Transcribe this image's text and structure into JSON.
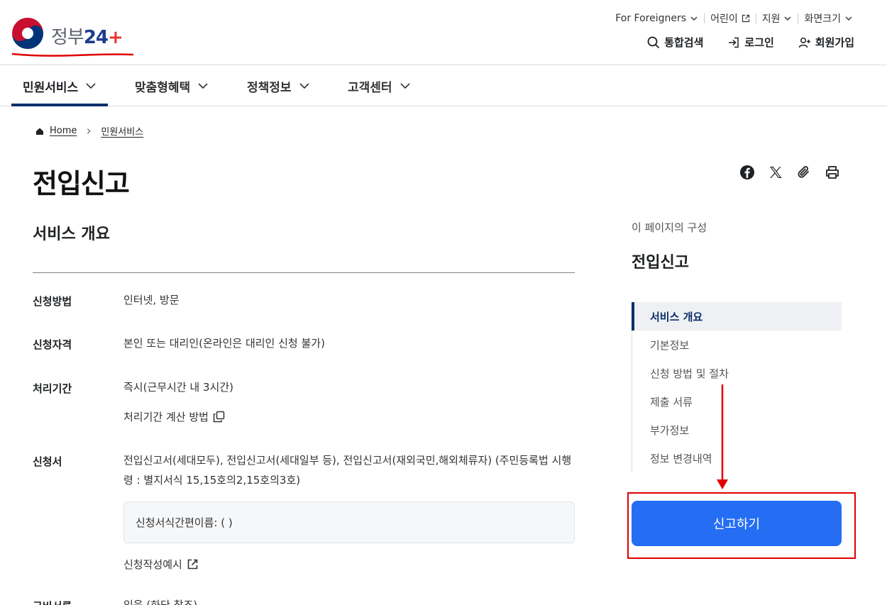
{
  "header": {
    "logo_text": "정부",
    "logo_num": "24",
    "util": {
      "foreigners": "For Foreigners",
      "kids": "어린이",
      "support": "지원",
      "screen_size": "화면크기"
    },
    "actions": {
      "search": "통합검색",
      "login": "로그인",
      "signup": "회원가입"
    }
  },
  "gnb": {
    "items": [
      {
        "label": "민원서비스"
      },
      {
        "label": "맞춤형혜택"
      },
      {
        "label": "정책정보"
      },
      {
        "label": "고객센터"
      }
    ]
  },
  "breadcrumb": {
    "home": "Home",
    "current": "민원서비스"
  },
  "page": {
    "title": "전입신고",
    "section_title": "서비스 개요"
  },
  "info": [
    {
      "label": "신청방법",
      "value": "인터넷, 방문"
    },
    {
      "label": "신청자격",
      "value": "본인 또는 대리인(온라인은 대리인 신청 불가)"
    },
    {
      "label": "처리기간",
      "value": "즉시(근무시간 내 3시간)"
    },
    {
      "label": "신청서",
      "value": "전입신고서(세대모두), 전입신고서(세대일부 등), 전입신고서(재외국민,해외체류자) (주민등록법 시행령 : 별지서식 15,15호의2,15호의3호)"
    },
    {
      "label": "구비서류",
      "value": "있음 (하단 참조)"
    }
  ],
  "links": {
    "calc_method": "처리기간 계산 방법",
    "form_short_name": "신청서식간편이름: ( )",
    "write_example": "신청작성예시"
  },
  "toc": {
    "caption": "이 페이지의 구성",
    "title": "전입신고",
    "items": [
      {
        "label": "서비스 개요"
      },
      {
        "label": "기본정보"
      },
      {
        "label": "신청 방법 및 절차"
      },
      {
        "label": "제출 서류"
      },
      {
        "label": "부가정보"
      },
      {
        "label": "정보 변경내역"
      }
    ]
  },
  "apply_button": "신고하기",
  "colors": {
    "primary": "#256ef4",
    "navy": "#0b2e6b",
    "annotation_red": "#e00000"
  }
}
